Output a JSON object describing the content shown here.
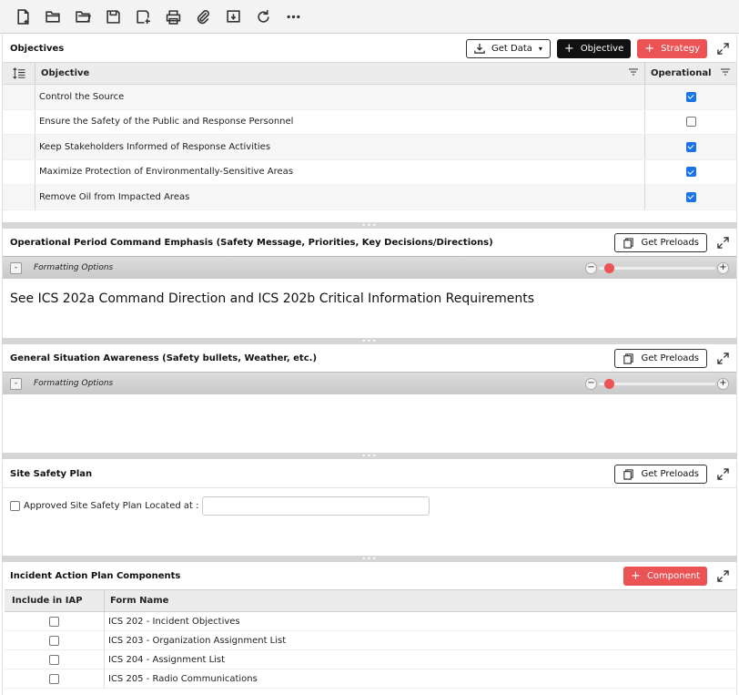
{
  "toolbar": {
    "icons": [
      "new-file-icon",
      "open-folder-icon",
      "open-folder-alt-icon",
      "save-icon",
      "save-as-icon",
      "print-icon",
      "attach-icon",
      "export-icon",
      "refresh-icon",
      "more-icon"
    ]
  },
  "objectives": {
    "title": "Objectives",
    "get_data_label": "Get Data",
    "objective_label": "Objective",
    "strategy_label": "Strategy",
    "col_objective": "Objective",
    "col_operational": "Operational",
    "rows": [
      {
        "text": "Control the Source",
        "operational": true
      },
      {
        "text": "Ensure the Safety of the Public and Response Personnel",
        "operational": false
      },
      {
        "text": "Keep Stakeholders Informed of Response Activities",
        "operational": true
      },
      {
        "text": "Maximize Protection of Environmentally-Sensitive Areas",
        "operational": true
      },
      {
        "text": "Remove Oil from Impacted Areas",
        "operational": true
      }
    ]
  },
  "command_emphasis": {
    "title": "Operational Period Command Emphasis (Safety Message, Priorities, Key Decisions/Directions)",
    "preloads_label": "Get Preloads",
    "formatting_label": "Formatting Options",
    "toggle": "-",
    "content": "See ICS 202a Command Direction and ICS 202b Critical Information Requirements"
  },
  "situation": {
    "title": "General Situation Awareness (Safety bullets, Weather, etc.)",
    "preloads_label": "Get Preloads",
    "formatting_label": "Formatting Options",
    "toggle": "-",
    "content": ""
  },
  "site_safety": {
    "title": "Site Safety Plan",
    "preloads_label": "Get Preloads",
    "checkbox_label": "Approved Site Safety Plan Located at :",
    "location_value": ""
  },
  "iap": {
    "title": "Incident Action Plan Components",
    "component_label": "Component",
    "col_include": "Include in IAP",
    "col_form": "Form Name",
    "rows": [
      {
        "form": "ICS 202 - Incident Objectives",
        "include": false
      },
      {
        "form": "ICS 203 - Organization Assignment List",
        "include": false
      },
      {
        "form": "ICS 204 - Assignment List",
        "include": false
      },
      {
        "form": "ICS 205 - Radio Communications",
        "include": false
      }
    ]
  },
  "zoom": {
    "minus": "−",
    "plus": "+",
    "level": 0.05
  },
  "colors": {
    "accent_red": "#ec5355",
    "checkbox_blue": "#1a73e8"
  }
}
